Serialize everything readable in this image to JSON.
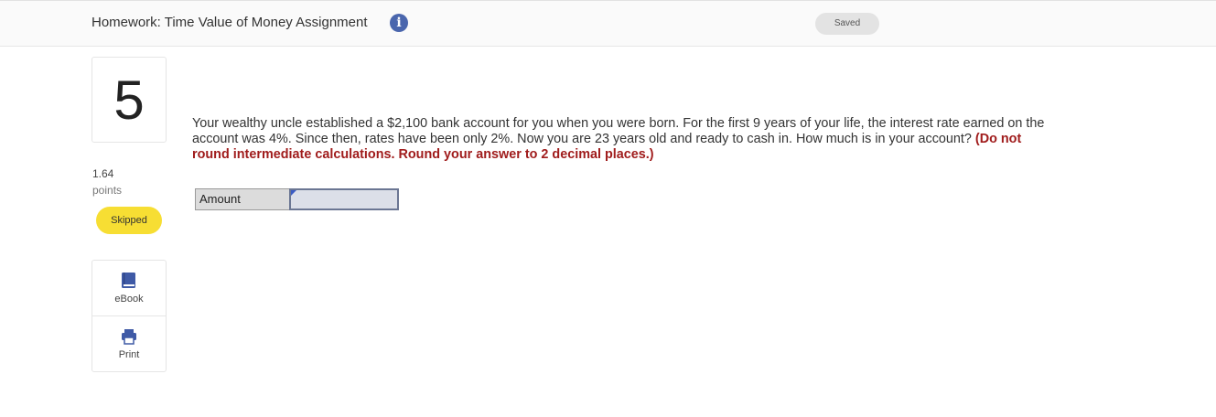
{
  "header": {
    "title": "Homework: Time Value of Money Assignment",
    "info_icon": "i",
    "status": "Saved"
  },
  "question": {
    "number": "5",
    "points_value": "1.64",
    "points_label": "points",
    "status_badge": "Skipped",
    "text": "Your wealthy uncle established a $2,100 bank account for you when you were born. For the first 9 years of your life, the interest rate earned on the account was 4%. Since then, rates have been only 2%. Now you are 23 years old and ready to cash in. How much is in your account?",
    "instruction": "(Do not round intermediate calculations. Round your answer to 2 decimal places.)",
    "answer_label": "Amount",
    "answer_value": ""
  },
  "tools": {
    "ebook_label": "eBook",
    "ebook_icon": "book-icon",
    "print_label": "Print",
    "print_icon": "printer-icon"
  },
  "colors": {
    "info_icon": "#4a66ad",
    "skipped_badge": "#f7de33",
    "instruction_text": "#a01c1c",
    "tool_icons": "#3f5aa6"
  }
}
